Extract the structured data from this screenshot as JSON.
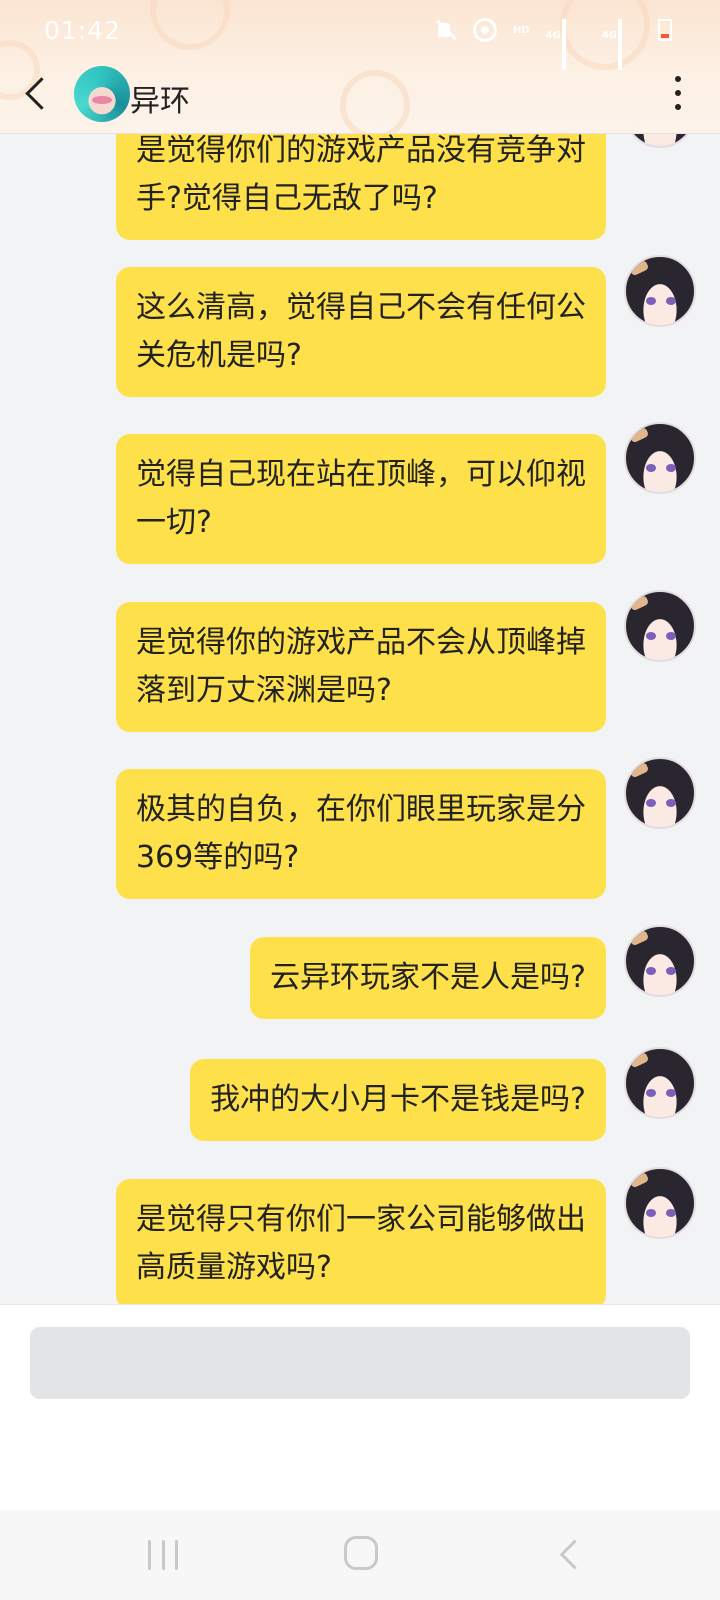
{
  "status_bar": {
    "time": "01:42",
    "icons": [
      "mute-icon",
      "hotspot-icon",
      "hd-icon",
      "signal-4g-icon",
      "signal-4g-icon",
      "wifi-signal-icon",
      "battery-low-icon"
    ],
    "hd_label": "HD",
    "net_label_1": "4G",
    "net_label_2": "4G"
  },
  "header": {
    "back_icon": "chevron-left-icon",
    "contact_name": "异环",
    "more_icon": "more-vertical-icon"
  },
  "messages": [
    {
      "lines": [
        "是觉得你们的游戏产品没有竞争对",
        "手?觉得自己无敌了吗?"
      ]
    },
    {
      "lines": [
        "这么清高，觉得自己不会有任何公",
        "关危机是吗?"
      ]
    },
    {
      "lines": [
        "觉得自己现在站在顶峰，可以仰视",
        "一切?"
      ]
    },
    {
      "lines": [
        "是觉得你的游戏产品不会从顶峰掉",
        "落到万丈深渊是吗?"
      ]
    },
    {
      "lines": [
        "极其的自负，在你们眼里玩家是分",
        "369等的吗?"
      ]
    },
    {
      "lines": [
        "云异环玩家不是人是吗?"
      ]
    },
    {
      "lines": [
        "我冲的大小月卡不是钱是吗?"
      ]
    },
    {
      "lines": [
        "是觉得只有你们一家公司能够做出",
        "高质量游戏吗?"
      ]
    }
  ],
  "input": {
    "placeholder": ""
  },
  "nav_bar": {
    "icons": [
      "recent-apps-icon",
      "home-icon",
      "back-icon"
    ]
  },
  "colors": {
    "bubble": "#fde04a",
    "chat_background": "#f2f3f5",
    "header_background": "#fdf0e4"
  }
}
